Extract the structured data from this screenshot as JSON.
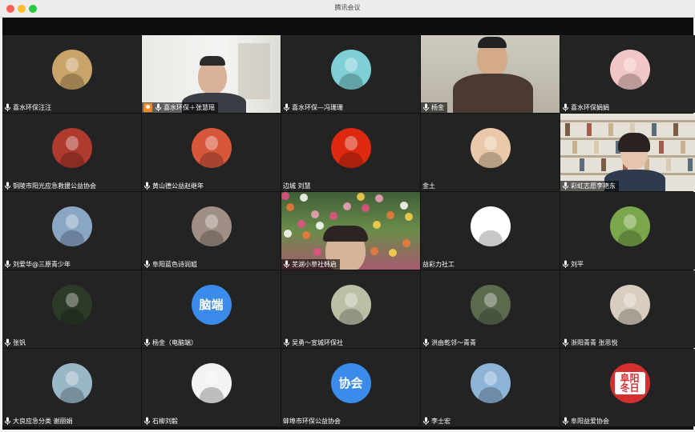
{
  "window": {
    "title": "腾讯会议",
    "accent_speaker": "#5bd35b"
  },
  "participants": [
    {
      "name": "喜水环保汪汪",
      "kind": "avatar",
      "icon": "teddy-bear-avatar",
      "bg": "#c9a46a"
    },
    {
      "name": "喜水环保＋张慧瑶",
      "kind": "video",
      "host": true,
      "icon": "video-man-glasses"
    },
    {
      "name": "喜水环保—冯珊珊",
      "kind": "avatar",
      "icon": "cartoon-girl-avatar",
      "bg": "#7fd0d6"
    },
    {
      "name": "杨金",
      "kind": "video",
      "speaker": true,
      "icon": "video-man-smiling"
    },
    {
      "name": "喜水环保娟娟",
      "kind": "avatar",
      "icon": "cartoon-baby-avatar",
      "bg": "#f3c6c6"
    },
    {
      "name": "铜陵市阳光应急救援公益协会",
      "kind": "avatar",
      "icon": "flag-photo-avatar",
      "bg": "#b03a2e"
    },
    {
      "name": "黄山德公益赵继年",
      "kind": "avatar",
      "icon": "group-photo-avatar",
      "bg": "#d7573b"
    },
    {
      "name": "边城 刘慧",
      "kind": "avatar",
      "no_mic": true,
      "icon": "china-flag-avatar",
      "bg": "#de2910"
    },
    {
      "name": "金土",
      "kind": "avatar",
      "no_mic": true,
      "icon": "child-photo-avatar",
      "bg": "#e9c9a9"
    },
    {
      "name": "彩虹志愿李艳东",
      "kind": "video",
      "icon": "video-woman-bookshelf"
    },
    {
      "name": "刘爱华@三原青少年",
      "kind": "avatar",
      "icon": "man-portrait-avatar",
      "bg": "#8aa6c4"
    },
    {
      "name": "阜阳蓝色诗润姐",
      "kind": "avatar",
      "icon": "sunset-couple-avatar",
      "bg": "#9f8f85"
    },
    {
      "name": "芜湖小草社韩启",
      "kind": "video",
      "icon": "video-flowers"
    },
    {
      "name": "益彩力社工",
      "kind": "avatar",
      "no_mic": true,
      "icon": "logo-heart-avatar",
      "bg": "#ffffff"
    },
    {
      "name": "刘平",
      "kind": "avatar",
      "icon": "aerial-field-avatar",
      "bg": "#7ba74c"
    },
    {
      "name": "张钒",
      "kind": "avatar",
      "icon": "flower-avatar",
      "bg": "#2d3a28"
    },
    {
      "name": "杨金（电脑端）",
      "kind": "text-avatar",
      "text": "脑端",
      "bg": "#3b8beb"
    },
    {
      "name": "吴勇～宣城环保社",
      "kind": "avatar",
      "icon": "man-yellow-avatar",
      "bg": "#b9c0a6"
    },
    {
      "name": "洪由乾邻～青青",
      "kind": "avatar",
      "icon": "bicycle-kid-avatar",
      "bg": "#5c6b4e"
    },
    {
      "name": "浙阳青青 张思悦",
      "kind": "avatar",
      "icon": "woman-photo-avatar",
      "bg": "#d9cdbf"
    },
    {
      "name": "大良应急分类 谢丽娟",
      "kind": "avatar",
      "icon": "woman-water-avatar",
      "bg": "#9ab7c7"
    },
    {
      "name": "石柳刘毅",
      "kind": "avatar",
      "icon": "cartoon-man-avatar",
      "bg": "#f3f3f3"
    },
    {
      "name": "蚌埠市环保公益协会",
      "kind": "text-avatar",
      "text": "协会",
      "bg": "#3b8beb",
      "no_mic": true
    },
    {
      "name": "李士宏",
      "kind": "avatar",
      "icon": "man-outdoor-avatar",
      "bg": "#8db3d6"
    },
    {
      "name": "阜阳益爱协会",
      "kind": "text-avatar",
      "text": "阜阳冬日",
      "bg": "#d32f2f",
      "icon": "calligraphy-logo"
    }
  ]
}
